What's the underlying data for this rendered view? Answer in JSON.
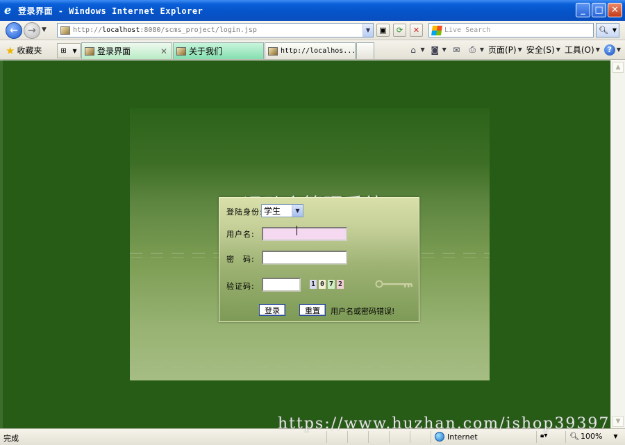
{
  "window": {
    "title": "登录界面 - Windows Internet Explorer",
    "minimize_label": "_",
    "maximize_label": "□",
    "close_label": "✕"
  },
  "addressbar": {
    "url_prefix": "http://",
    "url_host": "localhost",
    "url_rest": ":8080/scms_project/login.jsp",
    "search_placeholder": "Live Search"
  },
  "toolbar": {
    "favorites_label": "收藏夹",
    "tabs": [
      {
        "label": "登录界面",
        "active": true
      },
      {
        "label": "关于我们",
        "active": false
      },
      {
        "label": "http://localhos...",
        "active": false
      }
    ],
    "commands": {
      "page_label": "页面(P)",
      "safety_label": "安全(S)",
      "tools_label": "工具(O)"
    }
  },
  "page": {
    "system_title": "运动会管理系统",
    "role_label": "登陆身份:",
    "role_selected": "学生",
    "username_label": "用户名:",
    "username_value": "",
    "password_label": "密　码:",
    "password_value": "",
    "captcha_label": "验证码:",
    "captcha_value": "",
    "captcha_digits": [
      "1",
      "0",
      "7",
      "2"
    ],
    "login_button": "登录",
    "reset_button": "重置",
    "error_message": "用户名或密码错误!"
  },
  "statusbar": {
    "status_text": "完成",
    "zone_label": "Internet",
    "zoom_label": "100%"
  },
  "watermark": "https://www.huzhan.com/ishop39397",
  "colors": {
    "page_background": "#275c17",
    "error_text": "#000000"
  }
}
